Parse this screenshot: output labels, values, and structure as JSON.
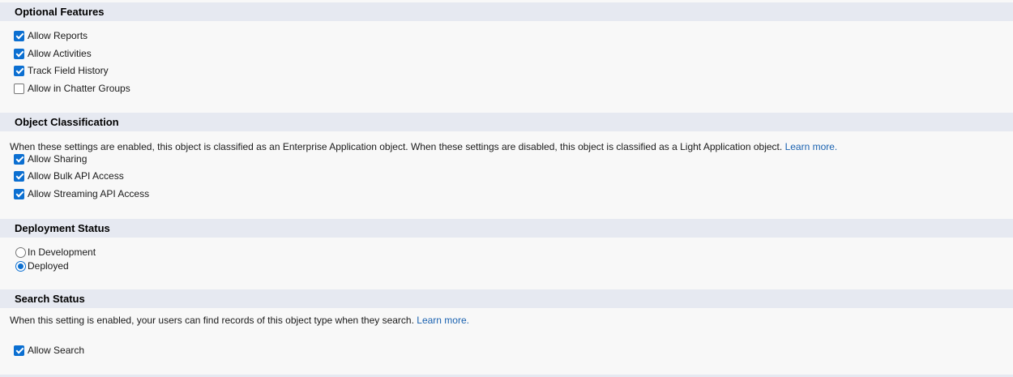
{
  "optional_features": {
    "title": "Optional Features",
    "allow_reports": "Allow Reports",
    "allow_activities": "Allow Activities",
    "track_field_history": "Track Field History",
    "allow_chatter_groups": "Allow in Chatter Groups"
  },
  "object_classification": {
    "title": "Object Classification",
    "description": "When these settings are enabled, this object is classified as an Enterprise Application object. When these settings are disabled, this object is classified as a Light Application object.",
    "learn_more": "Learn more.",
    "allow_sharing": "Allow Sharing",
    "allow_bulk_api": "Allow Bulk API Access",
    "allow_streaming_api": "Allow Streaming API Access"
  },
  "deployment_status": {
    "title": "Deployment Status",
    "in_development": "In Development",
    "deployed": "Deployed"
  },
  "search_status": {
    "title": "Search Status",
    "description": "When this setting is enabled, your users can find records of this object type when they search.",
    "learn_more": "Learn more.",
    "allow_search": "Allow Search"
  },
  "colors": {
    "accent": "#0b6fd1",
    "header_bg": "#e6e9f1",
    "link": "#1a62b0"
  }
}
